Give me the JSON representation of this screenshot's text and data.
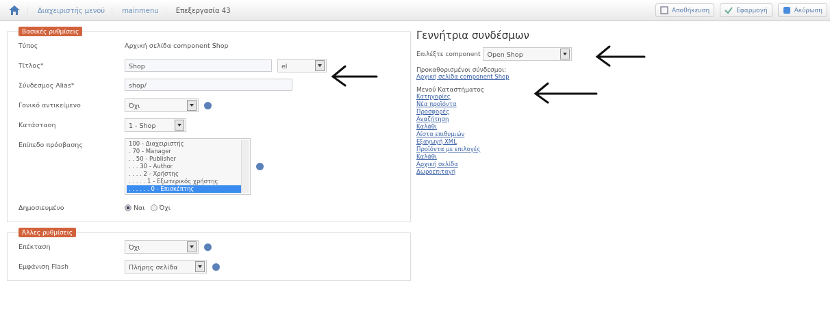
{
  "breadcrumb": [
    "Διαχειριστής μενού",
    "mainmenu",
    "Επεξεργασία 43"
  ],
  "toolbar": [
    "Αποθήκευση",
    "Εφαρμογή",
    "Ακύρωση"
  ],
  "basic": {
    "legend": "Βασικές ρυθμίσεις",
    "rows": [
      {
        "kind": "text",
        "label": "Τύπος",
        "value": "Αρχική σελίδα component Shop"
      },
      {
        "kind": "title",
        "label": "Τίτλος*",
        "value": "Shop",
        "lang": "el"
      },
      {
        "kind": "input",
        "label": "Σύνδεσμος Alias*",
        "value": "shop/"
      },
      {
        "kind": "select",
        "label": "Γονικό αντικείμενο",
        "value": "Όχι",
        "info": true
      },
      {
        "kind": "select",
        "label": "Κατάσταση",
        "value": "1 - Shop",
        "info": false
      },
      {
        "kind": "list",
        "label": "Επίπεδο πρόσβασης",
        "info": true,
        "options": [
          {
            "label": "100 - Διαχειριστής",
            "selected": false
          },
          {
            "label": ". 70 - Manager",
            "selected": false
          },
          {
            "label": ". . 50 - Publisher",
            "selected": false
          },
          {
            "label": ". . . 30 - Author",
            "selected": false
          },
          {
            "label": ". . . . 2 - Χρήστης",
            "selected": false
          },
          {
            "label": ". . . . . 1 - Εξωτερικός χρήστης",
            "selected": false
          },
          {
            "label": ". . . . . . 0 - Επισκέπτης",
            "selected": true
          }
        ]
      },
      {
        "kind": "radio",
        "label": "Δημοσιευμένο",
        "options": [
          {
            "label": "Ναι",
            "selected": true
          },
          {
            "label": "Όχι",
            "selected": false
          }
        ]
      }
    ]
  },
  "other": {
    "legend": "Άλλες ρυθμίσεις",
    "rows": [
      {
        "kind": "select",
        "label": "Επέκταση",
        "value": "Όχι",
        "info": true
      },
      {
        "kind": "select",
        "label": "Εμφάνιση Flash",
        "value": "Πλήρης σελίδα",
        "info": true
      }
    ]
  },
  "generator": {
    "title": "Γεννήτρια συνδέσμων",
    "component_label": "Επιλέξτε component",
    "component_value": "Open Shop",
    "preset_title": "Προκαθορισμένοι σύνδεσμοι:",
    "preset_links": [
      "Αρχική σελίδα component Shop"
    ],
    "menu_title": "Μενού Καταστήματος",
    "menu_links": [
      "Κατηγορίες",
      "Νέα προϊόντα",
      "Προσφορές",
      "Αναζήτηση",
      "Καλάθι",
      "Λίστα επιθυμιών",
      "Εξαγωγή XML",
      "Προϊόντα με επιλογές",
      "Καλάθι",
      "Αρχική σελίδα",
      "Δωροεπιταγή"
    ]
  }
}
